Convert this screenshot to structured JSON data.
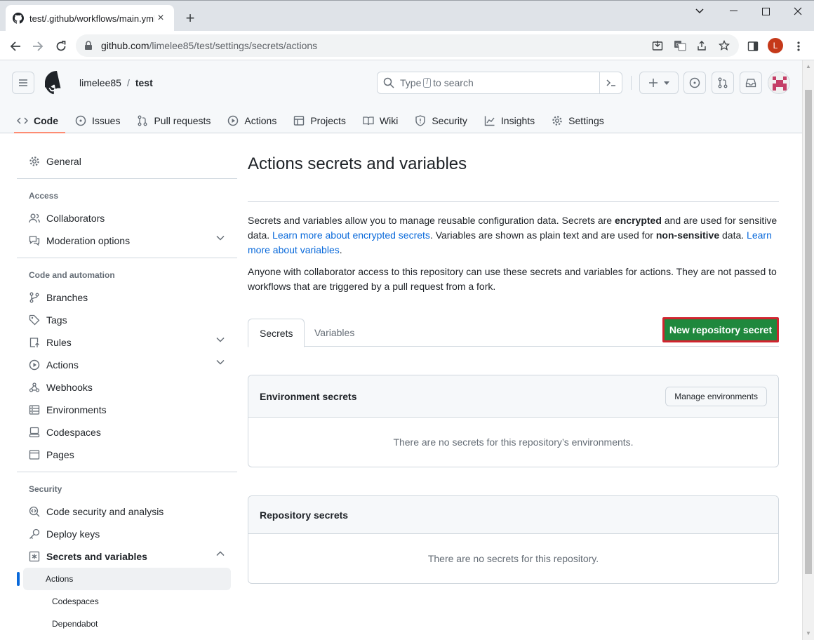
{
  "browser": {
    "tab_title": "test/.github/workflows/main.yml",
    "url_host": "github.com",
    "url_path": "/limelee85/test/settings/secrets/actions",
    "profile_initial": "L"
  },
  "header": {
    "owner": "limelee85",
    "separator": "/",
    "repo": "test",
    "search_type": "Type",
    "search_key": "/",
    "search_rest": "to search"
  },
  "repo_nav": [
    {
      "label": "Code",
      "icon": "code-icon"
    },
    {
      "label": "Issues",
      "icon": "issue-icon"
    },
    {
      "label": "Pull requests",
      "icon": "pull-request-icon"
    },
    {
      "label": "Actions",
      "icon": "play-icon"
    },
    {
      "label": "Projects",
      "icon": "table-icon"
    },
    {
      "label": "Wiki",
      "icon": "book-icon"
    },
    {
      "label": "Security",
      "icon": "shield-icon"
    },
    {
      "label": "Insights",
      "icon": "graph-icon"
    },
    {
      "label": "Settings",
      "icon": "gear-icon"
    }
  ],
  "sidebar": {
    "general": "General",
    "access_heading": "Access",
    "collaborators": "Collaborators",
    "moderation": "Moderation options",
    "code_heading": "Code and automation",
    "branches": "Branches",
    "tags": "Tags",
    "rules": "Rules",
    "actions": "Actions",
    "webhooks": "Webhooks",
    "environments": "Environments",
    "codespaces": "Codespaces",
    "pages": "Pages",
    "security_heading": "Security",
    "code_security": "Code security and analysis",
    "deploy_keys": "Deploy keys",
    "secrets_vars": "Secrets and variables",
    "sub_actions": "Actions",
    "sub_codespaces": "Codespaces",
    "sub_dependabot": "Dependabot"
  },
  "main": {
    "title": "Actions secrets and variables",
    "p1_a": "Secrets and variables allow you to manage reusable configuration data. Secrets are ",
    "p1_b": "encrypted",
    "p1_c": " and are used for sensitive data. ",
    "p1_link1": "Learn more about encrypted secrets",
    "p1_d": ". Variables are shown as plain text and are used for ",
    "p1_e": "non-sensitive",
    "p1_f": " data. ",
    "p1_link2": "Learn more about variables",
    "p1_g": ".",
    "p2": "Anyone with collaborator access to this repository can use these secrets and variables for actions. They are not passed to workflows that are triggered by a pull request from a fork.",
    "tab_secrets": "Secrets",
    "tab_variables": "Variables",
    "new_secret": "New repository secret",
    "env_title": "Environment secrets",
    "manage_env": "Manage environments",
    "env_empty": "There are no secrets for this repository’s environments.",
    "repo_title": "Repository secrets",
    "repo_empty": "There are no secrets for this repository."
  },
  "colors": {
    "primary_button": "#1f883d",
    "highlight_border": "#d1242f",
    "link": "#0969da",
    "active_tab_underline": "#fd8c73"
  }
}
